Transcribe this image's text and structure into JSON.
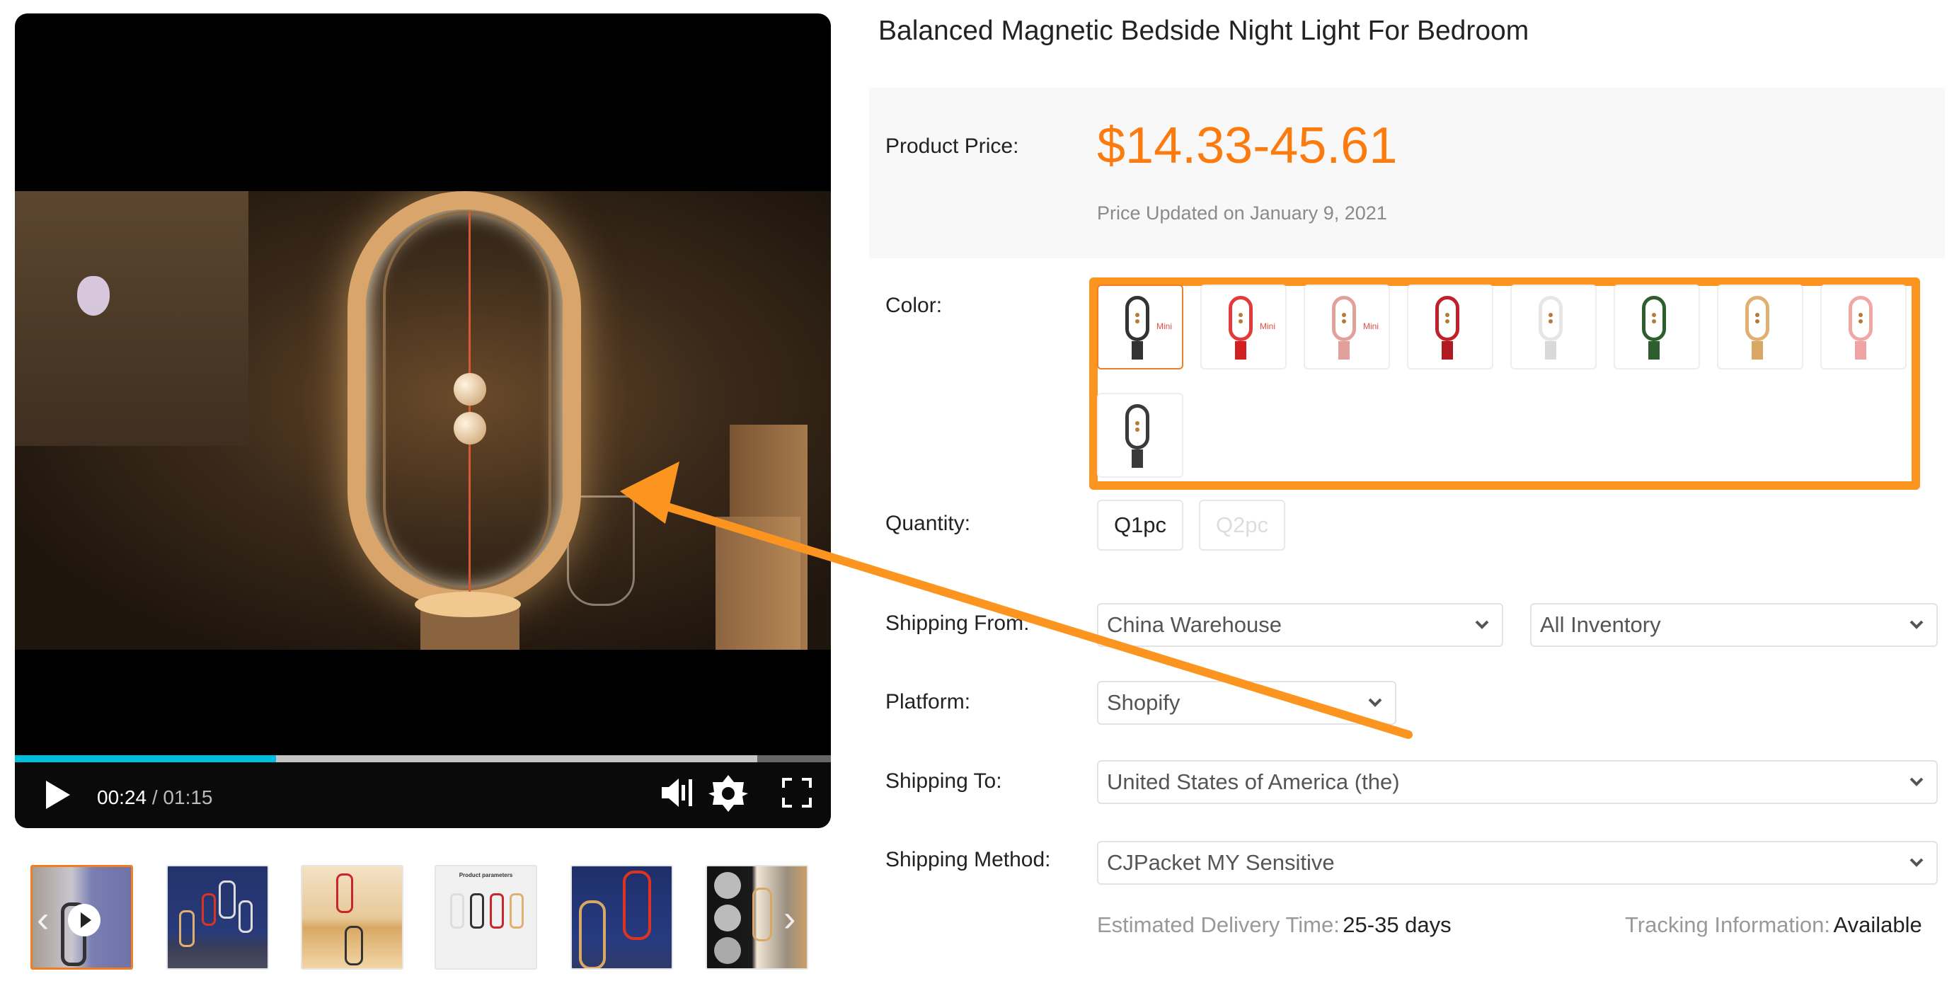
{
  "product": {
    "title": "Balanced Magnetic Bedside Night Light For Bedroom",
    "price_label": "Product Price:",
    "price": "$14.33-45.61",
    "price_updated": "Price Updated on January 9, 2021",
    "accent_color": "#fc7b0e"
  },
  "video": {
    "current_time": "00:24",
    "separator": " / ",
    "duration": "01:15",
    "played_fraction": 0.32,
    "buffered_fraction": 0.91,
    "controls": [
      "play-icon",
      "volume-mute-icon",
      "gear-icon",
      "fullscreen-icon"
    ]
  },
  "thumbnails": [
    {
      "label": "video thumbnail",
      "active": true
    },
    {
      "label": "lamps on blue background"
    },
    {
      "label": "lamps in living room"
    },
    {
      "label": "product parameters"
    },
    {
      "label": "red and wood lamps"
    },
    {
      "label": "lamp with moon pictures"
    }
  ],
  "thumbnail_text": {
    "params_heading": "Product parameters"
  },
  "color": {
    "label": "Color:",
    "swatches": [
      {
        "name": "Black Mini",
        "frame": "#333333",
        "base": "#333333",
        "mini": "Mini",
        "selected": true
      },
      {
        "name": "Red Mini",
        "frame": "#e23b3b",
        "base": "#d21f1f",
        "mini": "Mini"
      },
      {
        "name": "Pink Mini",
        "frame": "#e2a09a",
        "base": "#e2a09a",
        "mini": "Mini"
      },
      {
        "name": "Red",
        "frame": "#c0202a",
        "base": "#b01a22"
      },
      {
        "name": "White",
        "frame": "#e6e6e6",
        "base": "#d9d9d9"
      },
      {
        "name": "Green",
        "frame": "#2e5e2e",
        "base": "#2e5e2e"
      },
      {
        "name": "Wood",
        "frame": "#e0b070",
        "base": "#d9a764"
      },
      {
        "name": "Pink",
        "frame": "#f2a7a7",
        "base": "#f0a3a3"
      },
      {
        "name": "Black",
        "frame": "#3a3a3a",
        "base": "#3a3a3a"
      }
    ],
    "highlight_color": "#fc9420"
  },
  "quantity": {
    "label": "Quantity:",
    "options": [
      {
        "label": "Q1pc",
        "enabled": true
      },
      {
        "label": "Q2pc",
        "enabled": false
      }
    ]
  },
  "shipping_from": {
    "label": "Shipping From:",
    "warehouse": "China Warehouse",
    "inventory": "All Inventory"
  },
  "platform": {
    "label": "Platform:",
    "value": "Shopify"
  },
  "shipping_to": {
    "label": "Shipping To:",
    "value": "United States of America (the)"
  },
  "shipping_method": {
    "label": "Shipping Method:",
    "value": "CJPacket MY Sensitive"
  },
  "delivery": {
    "estimated_label": "Estimated Delivery Time:",
    "estimated_value": "25-35 days",
    "tracking_label": "Tracking Information:",
    "tracking_value": "Available"
  },
  "annotation": {
    "arrow_color": "#fc9420"
  }
}
